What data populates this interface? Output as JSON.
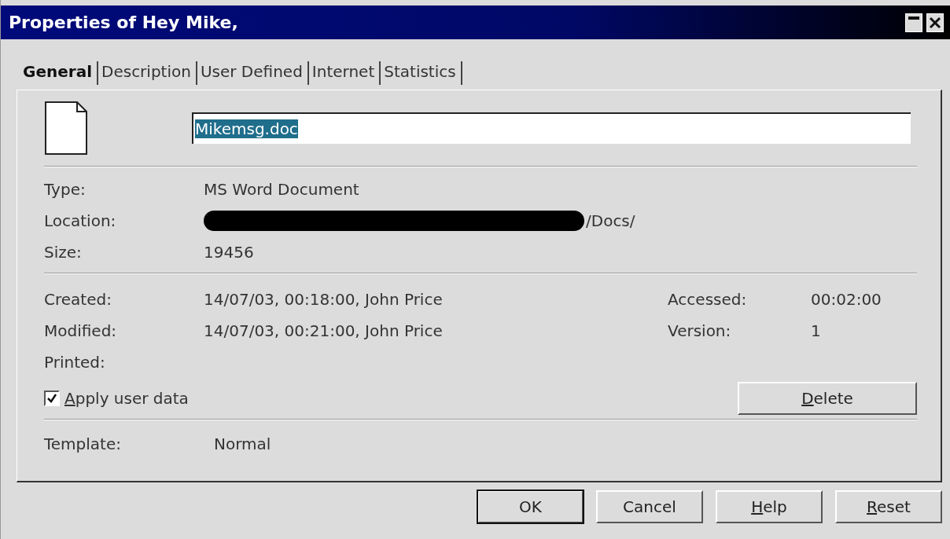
{
  "window": {
    "title": "Properties of Hey Mike,"
  },
  "tabs": [
    {
      "label": "General",
      "selected": true
    },
    {
      "label": "Description",
      "selected": false
    },
    {
      "label": "User Defined",
      "selected": false
    },
    {
      "label": "Internet",
      "selected": false
    },
    {
      "label": "Statistics",
      "selected": false
    }
  ],
  "file_name": {
    "value": "Mikemsg.doc",
    "selected": true
  },
  "info": [
    {
      "label": "Type:",
      "value": "MS Word Document",
      "redacted": false
    },
    {
      "label": "Location:",
      "value": "/Docs/",
      "redacted": true
    },
    {
      "label": "Size:",
      "value": "19456",
      "redacted": false
    }
  ],
  "dates": [
    {
      "label": "Created:",
      "value": "14/07/03, 00:18:00, John Price",
      "side_label": "Accessed:",
      "side_value": "00:02:00"
    },
    {
      "label": "Modified:",
      "value": "14/07/03, 00:21:00, John Price",
      "side_label": "Version:",
      "side_value": "1"
    },
    {
      "label": "Printed:"
    }
  ],
  "apply_user_data": {
    "label": "Apply user data",
    "checked": true,
    "underline_first": true
  },
  "delete_button": {
    "label": "Delete",
    "underline_first": true
  },
  "template": {
    "label": "Template:",
    "value": "Normal"
  },
  "buttons": [
    {
      "label": "OK",
      "default": true,
      "underline_first": false
    },
    {
      "label": "Cancel",
      "default": false,
      "underline_first": false
    },
    {
      "label": "Help",
      "default": false,
      "underline_first": true
    },
    {
      "label": "Reset",
      "default": false,
      "underline_first": true
    }
  ]
}
